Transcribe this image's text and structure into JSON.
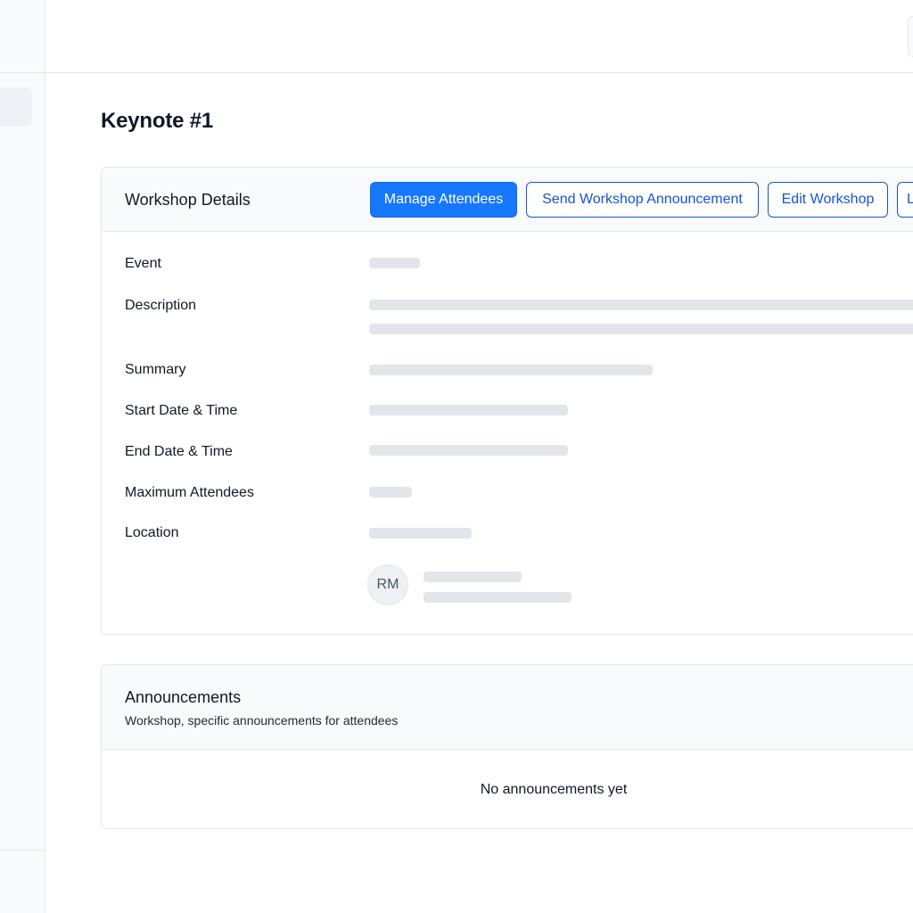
{
  "page": {
    "title": "Keynote #1"
  },
  "details": {
    "title": "Workshop Details",
    "actions": {
      "manage_attendees": "Manage Attendees",
      "send_announcement": "Send Workshop Announcement",
      "edit_workshop": "Edit Workshop",
      "more_label": "L"
    },
    "labels": {
      "event": "Event",
      "description": "Description",
      "summary": "Summary",
      "start": "Start Date & Time",
      "end": "End Date & Time",
      "max_attendees": "Maximum Attendees",
      "location": "Location"
    },
    "host": {
      "initials": "RM"
    }
  },
  "announcements": {
    "title": "Announcements",
    "subtitle": "Workshop, specific announcements for attendees",
    "empty": "No announcements yet"
  },
  "colors": {
    "primary": "#1677ff",
    "outline": "#1554d6",
    "skeleton": "#e2e5ea",
    "border": "#e5e7eb",
    "header_bg": "#f8fafc"
  }
}
